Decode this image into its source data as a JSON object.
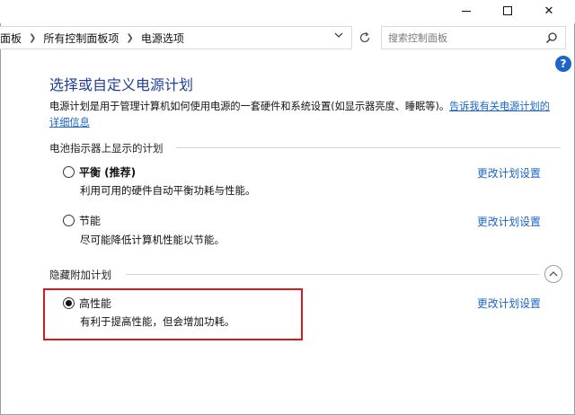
{
  "window": {
    "controls": {
      "minimize": "minimize",
      "maximize": "maximize",
      "close": "✕"
    }
  },
  "address": {
    "crumbs": [
      "面板",
      "所有控制面板项",
      "电源选项"
    ],
    "dropdown_icon": "chevron-down-icon",
    "refresh_icon": "refresh-icon"
  },
  "search": {
    "placeholder": "搜索控制面板",
    "icon": "search-icon"
  },
  "help": {
    "label": "?"
  },
  "main": {
    "title": "选择或自定义电源计划",
    "description": "电源计划是用于管理计算机如何使用电源的一套硬件和系统设置(如显示器亮度、睡眠等)。",
    "description_link": "告诉我有关电源计划的详细信息"
  },
  "sections": {
    "battery": {
      "header": "电池指示器上显示的计划",
      "plans": [
        {
          "name": "平衡 (推荐)",
          "desc": "利用可用的硬件自动平衡功耗与性能。",
          "link": "更改计划设置",
          "selected": false
        },
        {
          "name": "节能",
          "desc": "尽可能降低计算机性能以节能。",
          "link": "更改计划设置",
          "selected": false
        }
      ]
    },
    "hidden": {
      "header": "隐藏附加计划",
      "plans": [
        {
          "name": "高性能",
          "desc": "有利于提高性能，但会增加功耗。",
          "link": "更改计划设置",
          "selected": true
        }
      ]
    }
  },
  "colors": {
    "title": "#1f3f9a",
    "link": "#1a64c8",
    "highlight_border": "#d41c1c",
    "help": "#1c66c9"
  }
}
